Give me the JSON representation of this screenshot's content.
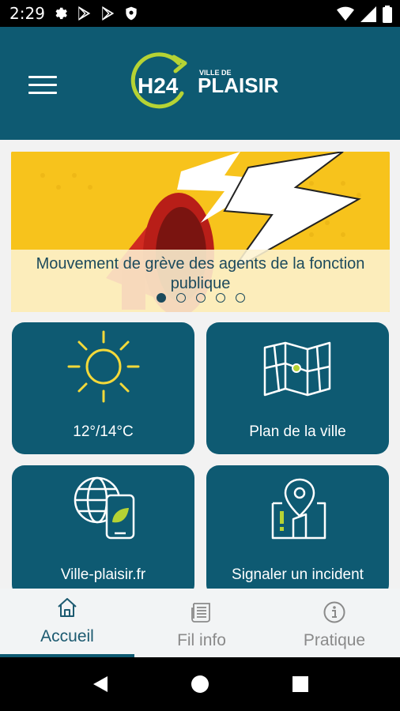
{
  "status_bar": {
    "time": "2:29",
    "left_icons": [
      "settings-icon",
      "play-store-icon",
      "play-store-icon",
      "shield-icon"
    ],
    "right_icons": [
      "wifi-icon",
      "signal-icon",
      "battery-icon"
    ]
  },
  "header": {
    "menu_icon": "hamburger-menu-icon",
    "logo": {
      "badge": "H24",
      "small_text": "VILLE DE",
      "big_text": "PLAISIR"
    }
  },
  "banner": {
    "caption": "Mouvement de grève des agents de la fonction publique",
    "slide_count": 5,
    "active_slide": 1
  },
  "tiles": [
    {
      "icon": "sun-icon",
      "label": "12°/14°C"
    },
    {
      "icon": "map-icon",
      "label": "Plan de la ville"
    },
    {
      "icon": "globe-phone-icon",
      "label": "Ville-plaisir.fr"
    },
    {
      "icon": "location-incident-icon",
      "label": "Signaler un incident"
    }
  ],
  "bottom_nav": {
    "items": [
      {
        "icon": "home-icon",
        "label": "Accueil",
        "active": true
      },
      {
        "icon": "newspaper-icon",
        "label": "Fil info",
        "active": false
      },
      {
        "icon": "info-icon",
        "label": "Pratique",
        "active": false
      }
    ]
  },
  "colors": {
    "primary": "#0e5a72",
    "accent": "#b6d334",
    "banner_yellow": "#f7c31c",
    "background": "#f2f2f2",
    "nav_active": "#1c5a70",
    "nav_inactive": "#8a8a8a"
  }
}
